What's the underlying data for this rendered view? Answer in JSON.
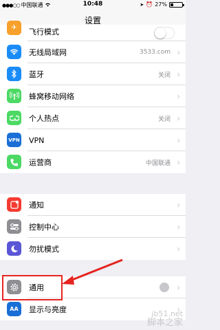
{
  "status_bar": {
    "carrier": "中国联通",
    "time": "10:48",
    "battery": "27%",
    "battery_level": 0.27
  },
  "nav": {
    "title": "设置"
  },
  "group1": [
    {
      "label": "飞行模式",
      "visible_label": "飞行模式",
      "icon": "airplane-icon",
      "color": "#f7a02c"
    },
    {
      "label": "无线局域网",
      "value": "3533.com",
      "icon": "wifi-icon",
      "color": "#1a8cf7"
    },
    {
      "label": "蓝牙",
      "value": "关闭",
      "icon": "bluetooth-icon",
      "color": "#1a8cf7"
    },
    {
      "label": "蜂窝移动网络",
      "value": "",
      "icon": "cellular-icon",
      "color": "#4cd964"
    },
    {
      "label": "个人热点",
      "value": "关闭",
      "icon": "hotspot-icon",
      "color": "#4cd964"
    },
    {
      "label": "VPN",
      "value": "",
      "icon_text": "VPN",
      "icon": "vpn-icon",
      "color": "#1a6fd6"
    },
    {
      "label": "运营商",
      "value": "中国联通",
      "icon": "phone-icon",
      "color": "#4cd964"
    }
  ],
  "group2": [
    {
      "label": "通知",
      "icon": "notifications-icon",
      "color": "#f53b30"
    },
    {
      "label": "控制中心",
      "icon": "control-center-icon",
      "color": "#8e8e93"
    },
    {
      "label": "勿扰模式",
      "icon": "moon-icon",
      "color": "#5a56d6"
    }
  ],
  "group3": [
    {
      "label": "通用",
      "icon": "gear-icon",
      "color": "#8e8e93"
    },
    {
      "label": "显示与亮度",
      "icon": "display-icon",
      "color": "#1a6fd6",
      "icon_text": "AA"
    }
  ],
  "annotation_color": "#e52420",
  "watermark": {
    "line1": "jb51.net",
    "line2": "脚本之家"
  }
}
